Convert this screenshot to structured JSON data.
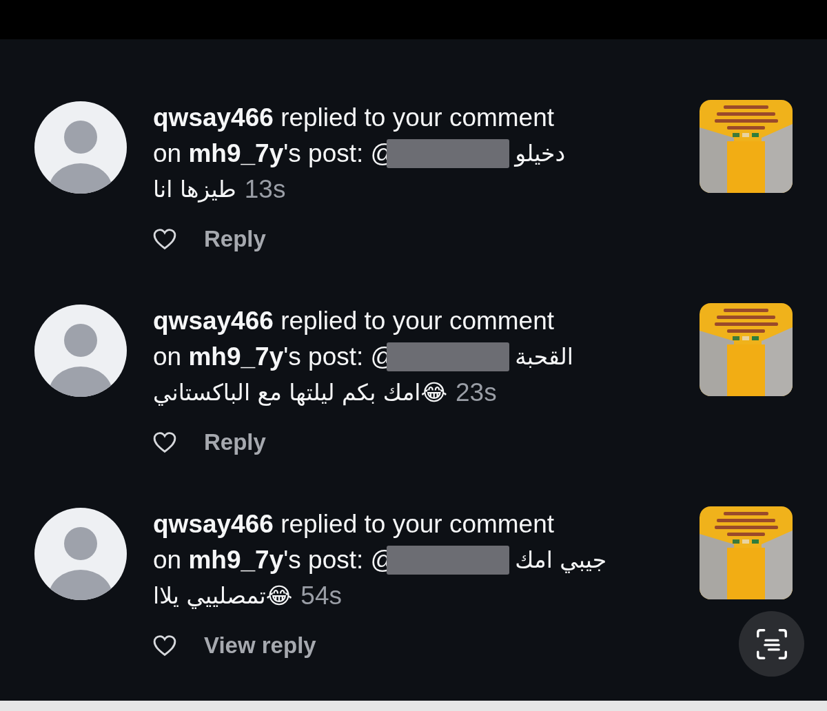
{
  "notifications": [
    {
      "headline": "**qwsay466** replied to your comment",
      "post_line": "on **mh9_7y**'s post: @",
      "comment_start": "دخيلو",
      "comment_end": "طيزها انا",
      "time": "13s",
      "liked": false,
      "action": "Reply"
    },
    {
      "headline": "**qwsay466** replied to your comment",
      "post_line": "on **mh9_7y**'s post: @",
      "comment_start": "القحبة",
      "comment_end": "😂امك بكم ليلتها مع الباكستاني",
      "time": "23s",
      "liked": false,
      "action": "Reply"
    },
    {
      "headline": "**qwsay466** replied to your comment",
      "post_line": "on **mh9_7y**'s post: @",
      "comment_start": "جيبي امك",
      "comment_end": "😂تمصلييي يلاا",
      "time": "54s",
      "liked": false,
      "action": "View reply"
    }
  ]
}
